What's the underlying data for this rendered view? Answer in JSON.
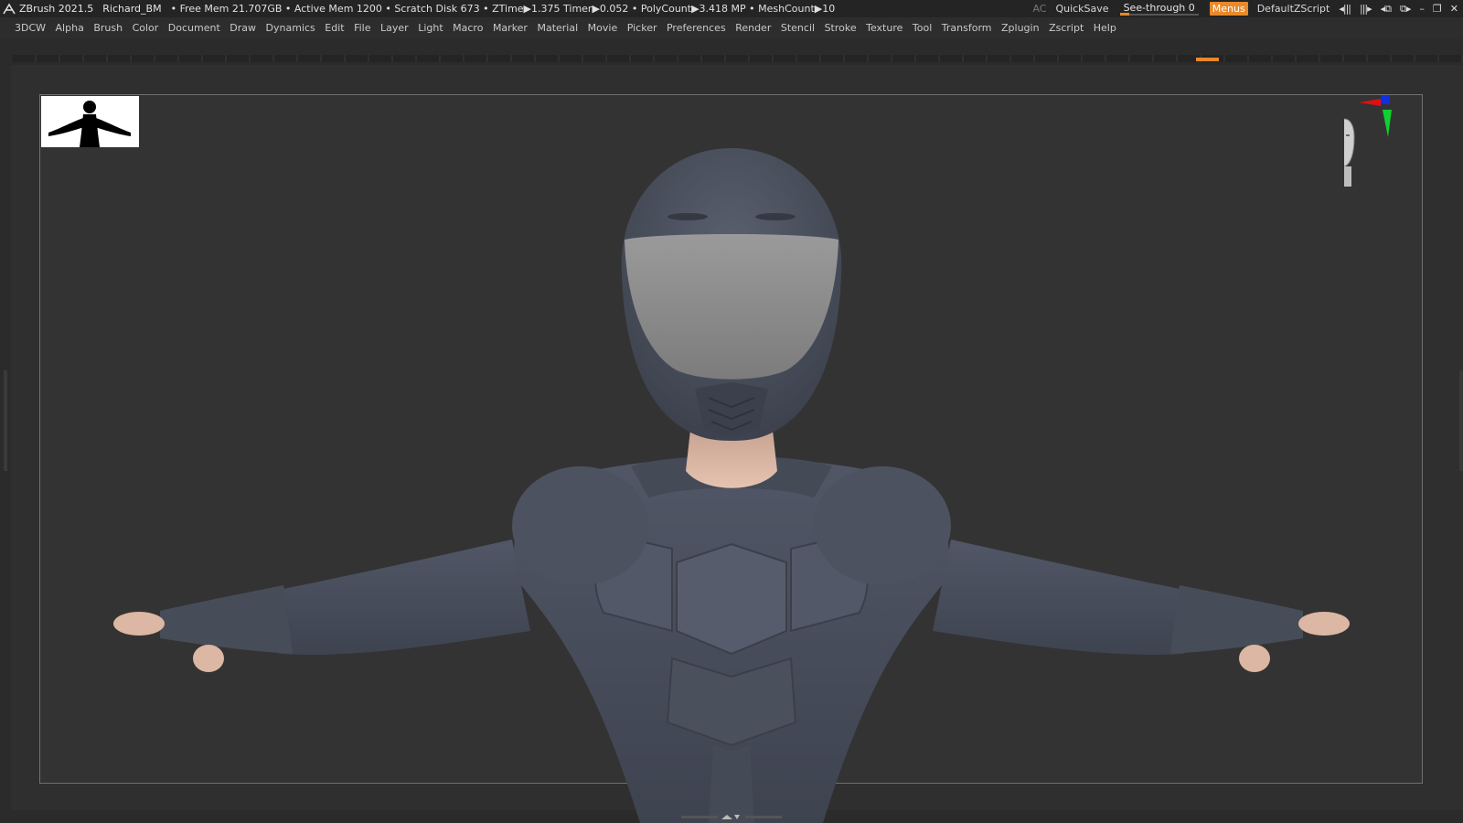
{
  "titlebar": {
    "app": "ZBrush 2021.5",
    "project": "Richard_BM",
    "stats": "• Free Mem 21.707GB • Active Mem 1200 • Scratch Disk 673 •  ZTime▶1.375 Timer▶0.052 • PolyCount▶3.418 MP  • MeshCount▶10",
    "ac": "AC",
    "quicksave": "QuickSave",
    "seethrough_label": "See-through  0",
    "seethrough_value": 0,
    "menus": "Menus",
    "script": "DefaultZScript",
    "icon_logo": "zbrush-logo-icon",
    "accent": "#e8892b"
  },
  "menu": [
    "3DCW",
    "Alpha",
    "Brush",
    "Color",
    "Document",
    "Draw",
    "Dynamics",
    "Edit",
    "File",
    "Layer",
    "Light",
    "Macro",
    "Marker",
    "Material",
    "Movie",
    "Picker",
    "Preferences",
    "Render",
    "Stencil",
    "Stroke",
    "Texture",
    "Tool",
    "Transform",
    "Zplugin",
    "Zscript",
    "Help"
  ],
  "viewport": {
    "background": "#333333",
    "model_color": "#4a4f5c",
    "visor_color": "#8a8a8a",
    "skin_color": "#e0b8a0"
  }
}
